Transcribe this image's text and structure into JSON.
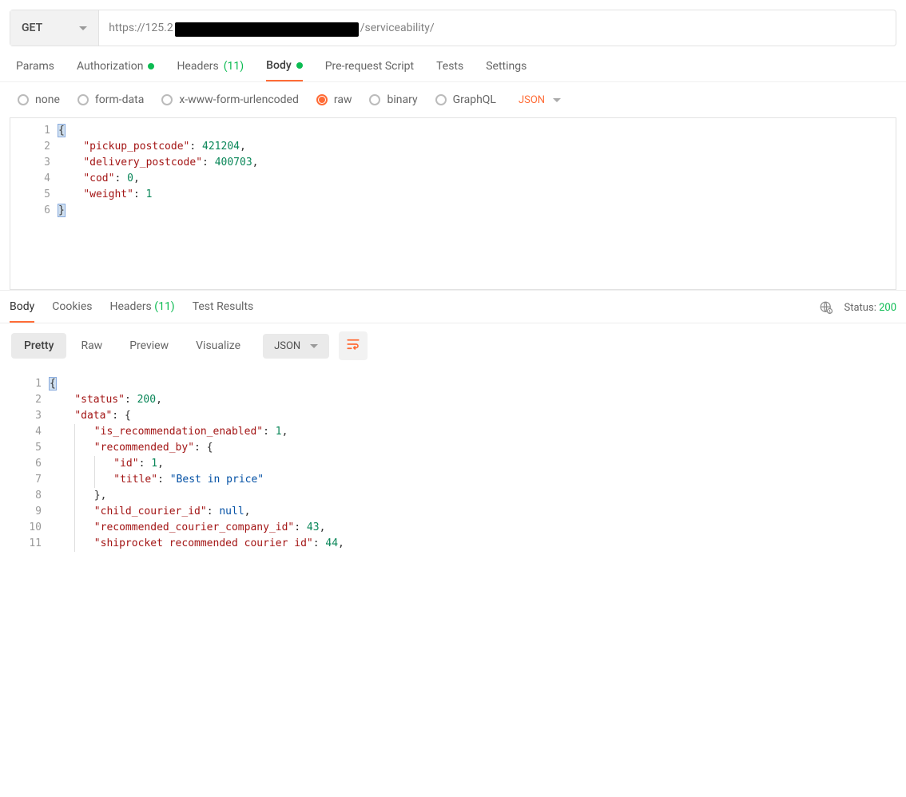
{
  "request": {
    "method": "GET",
    "url_prefix": "https://125.2",
    "url_suffix": "/serviceability/"
  },
  "tabs": {
    "params": "Params",
    "authorization": "Authorization",
    "headers": "Headers",
    "headers_count": "(11)",
    "body": "Body",
    "prerequest": "Pre-request Script",
    "tests": "Tests",
    "settings": "Settings"
  },
  "body_radios": {
    "none": "none",
    "form_data": "form-data",
    "urlencoded": "x-www-form-urlencoded",
    "raw": "raw",
    "binary": "binary",
    "graphql": "GraphQL",
    "format": "JSON"
  },
  "request_body_lines": [
    {
      "n": "1",
      "indent": "",
      "tokens": [
        {
          "t": "{",
          "c": "punc",
          "hl": true
        }
      ]
    },
    {
      "n": "2",
      "indent": "    ",
      "tokens": [
        {
          "t": "\"pickup_postcode\"",
          "c": "key"
        },
        {
          "t": ": ",
          "c": "punc"
        },
        {
          "t": "421204",
          "c": "num"
        },
        {
          "t": ",",
          "c": "punc"
        }
      ]
    },
    {
      "n": "3",
      "indent": "    ",
      "tokens": [
        {
          "t": "\"delivery_postcode\"",
          "c": "key"
        },
        {
          "t": ": ",
          "c": "punc"
        },
        {
          "t": "400703",
          "c": "num"
        },
        {
          "t": ",",
          "c": "punc"
        }
      ]
    },
    {
      "n": "4",
      "indent": "    ",
      "tokens": [
        {
          "t": "\"cod\"",
          "c": "key"
        },
        {
          "t": ": ",
          "c": "punc"
        },
        {
          "t": "0",
          "c": "num"
        },
        {
          "t": ",",
          "c": "punc"
        }
      ]
    },
    {
      "n": "5",
      "indent": "    ",
      "tokens": [
        {
          "t": "\"weight\"",
          "c": "key"
        },
        {
          "t": ": ",
          "c": "punc"
        },
        {
          "t": "1",
          "c": "num"
        }
      ]
    },
    {
      "n": "6",
      "indent": "",
      "tokens": [
        {
          "t": "}",
          "c": "punc",
          "hl": true
        }
      ]
    }
  ],
  "response_tabs": {
    "body": "Body",
    "cookies": "Cookies",
    "headers": "Headers",
    "headers_count": "(11)",
    "test_results": "Test Results"
  },
  "response_status": {
    "label": "Status:",
    "code": "200"
  },
  "response_toolbar": {
    "pretty": "Pretty",
    "raw": "Raw",
    "preview": "Preview",
    "visualize": "Visualize",
    "format": "JSON"
  },
  "response_body_lines": [
    {
      "n": "1",
      "indent": "",
      "guides": 0,
      "tokens": [
        {
          "t": "{",
          "c": "punc",
          "hl": true
        }
      ]
    },
    {
      "n": "2",
      "indent": "    ",
      "guides": 0,
      "tokens": [
        {
          "t": "\"status\"",
          "c": "key"
        },
        {
          "t": ": ",
          "c": "punc"
        },
        {
          "t": "200",
          "c": "num"
        },
        {
          "t": ",",
          "c": "punc"
        }
      ]
    },
    {
      "n": "3",
      "indent": "    ",
      "guides": 0,
      "tokens": [
        {
          "t": "\"data\"",
          "c": "key"
        },
        {
          "t": ": ",
          "c": "punc"
        },
        {
          "t": "{",
          "c": "punc"
        }
      ]
    },
    {
      "n": "4",
      "indent": "    ",
      "guides": 1,
      "tokens": [
        {
          "t": "\"is_recommendation_enabled\"",
          "c": "key"
        },
        {
          "t": ": ",
          "c": "punc"
        },
        {
          "t": "1",
          "c": "num"
        },
        {
          "t": ",",
          "c": "punc"
        }
      ]
    },
    {
      "n": "5",
      "indent": "    ",
      "guides": 1,
      "tokens": [
        {
          "t": "\"recommended_by\"",
          "c": "key"
        },
        {
          "t": ": ",
          "c": "punc"
        },
        {
          "t": "{",
          "c": "punc"
        }
      ]
    },
    {
      "n": "6",
      "indent": "    ",
      "guides": 2,
      "tokens": [
        {
          "t": "\"id\"",
          "c": "key"
        },
        {
          "t": ": ",
          "c": "punc"
        },
        {
          "t": "1",
          "c": "num"
        },
        {
          "t": ",",
          "c": "punc"
        }
      ]
    },
    {
      "n": "7",
      "indent": "    ",
      "guides": 2,
      "tokens": [
        {
          "t": "\"title\"",
          "c": "key"
        },
        {
          "t": ": ",
          "c": "punc"
        },
        {
          "t": "\"Best in price\"",
          "c": "str"
        }
      ]
    },
    {
      "n": "8",
      "indent": "    ",
      "guides": 1,
      "tokens": [
        {
          "t": "}",
          "c": "punc"
        },
        {
          "t": ",",
          "c": "punc"
        }
      ]
    },
    {
      "n": "9",
      "indent": "    ",
      "guides": 1,
      "tokens": [
        {
          "t": "\"child_courier_id\"",
          "c": "key"
        },
        {
          "t": ": ",
          "c": "punc"
        },
        {
          "t": "null",
          "c": "null"
        },
        {
          "t": ",",
          "c": "punc"
        }
      ]
    },
    {
      "n": "10",
      "indent": "    ",
      "guides": 1,
      "tokens": [
        {
          "t": "\"recommended_courier_company_id\"",
          "c": "key"
        },
        {
          "t": ": ",
          "c": "punc"
        },
        {
          "t": "43",
          "c": "num"
        },
        {
          "t": ",",
          "c": "punc"
        }
      ]
    },
    {
      "n": "11",
      "indent": "    ",
      "guides": 1,
      "tokens": [
        {
          "t": "\"shiprocket recommended courier id\"",
          "c": "key"
        },
        {
          "t": ": ",
          "c": "punc"
        },
        {
          "t": "44",
          "c": "num"
        },
        {
          "t": ",",
          "c": "punc"
        }
      ]
    }
  ]
}
